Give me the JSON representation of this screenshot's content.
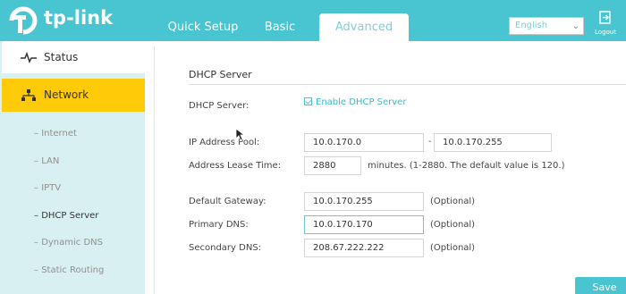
{
  "brand": {
    "logo_text": "tp-link",
    "accent": "#49c5d1"
  },
  "tabs": [
    {
      "label": "Quick Setup"
    },
    {
      "label": "Basic"
    },
    {
      "label": "Advanced"
    }
  ],
  "header": {
    "language": "English",
    "logout_label": "Logout"
  },
  "sidebar": {
    "status_label": "Status",
    "network_label": "Network",
    "subitems": [
      "Internet",
      "LAN",
      "IPTV",
      "DHCP Server",
      "Dynamic DNS",
      "Static Routing"
    ]
  },
  "form": {
    "section_title": "DHCP Server",
    "dhcp_server_label": "DHCP Server:",
    "enable_label": "Enable DHCP Server",
    "pool_label": "IP Address Pool:",
    "pool_start": "10.0.170.0",
    "pool_end": "10.0.170.255",
    "lease_label": "Address Lease Time:",
    "lease_value": "2880",
    "lease_hint": "minutes. (1-2880. The default value is 120.)",
    "gateway_label": "Default Gateway:",
    "gateway_value": "10.0.170.255",
    "primary_dns_label": "Primary DNS:",
    "primary_dns_value": "10.0.170.170",
    "secondary_dns_label": "Secondary DNS:",
    "secondary_dns_value": "208.67.222.222",
    "optional": "(Optional)",
    "save_label": "Save"
  }
}
